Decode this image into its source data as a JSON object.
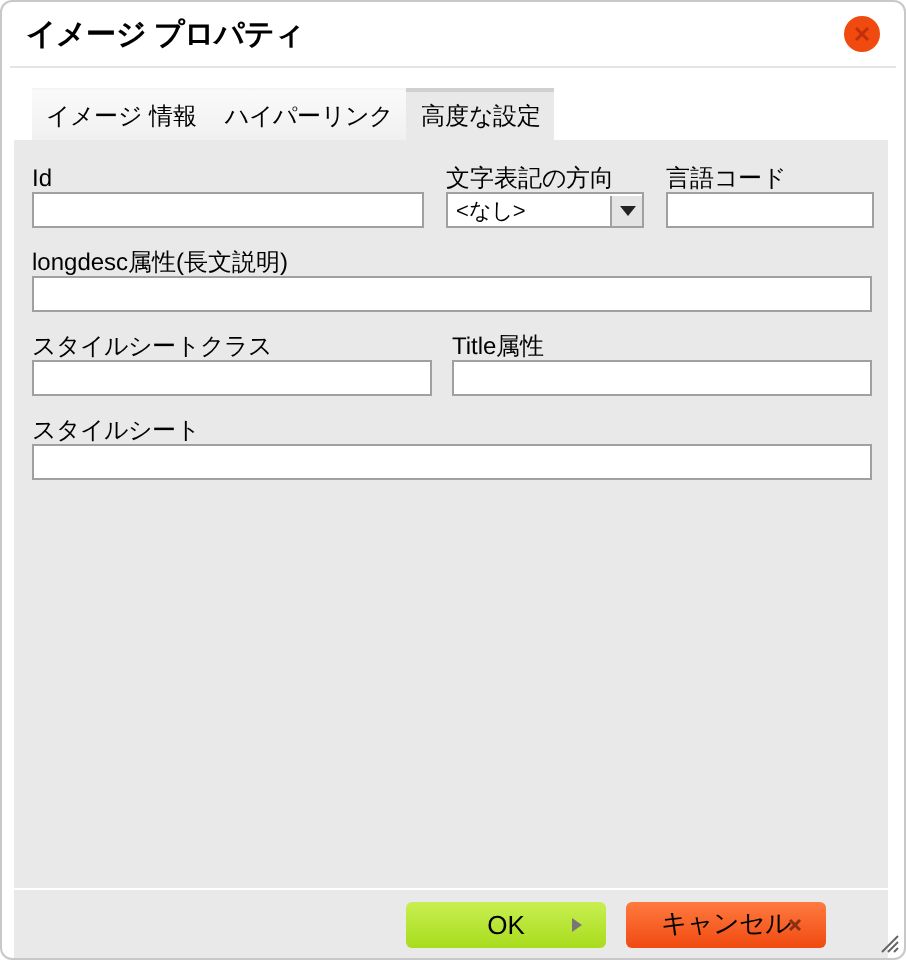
{
  "window": {
    "title": "イメージ プロパティ"
  },
  "tabs": [
    {
      "label": "イメージ 情報",
      "selected": false
    },
    {
      "label": "ハイパーリンク",
      "selected": false
    },
    {
      "label": "高度な設定",
      "selected": true
    }
  ],
  "rows": [
    [
      {
        "label": "Id",
        "kind": "text"
      },
      {
        "label": "文字表記の方向",
        "kind": "select",
        "value": "<なし>"
      },
      {
        "label": "言語コード",
        "kind": "text"
      }
    ],
    [
      {
        "label": "longdesc属性(長文説明)",
        "kind": "text"
      }
    ],
    [
      {
        "label": "スタイルシートクラス",
        "kind": "text"
      },
      {
        "label": "Title属性",
        "kind": "text"
      }
    ],
    [
      {
        "label": "スタイルシート",
        "kind": "text"
      }
    ]
  ],
  "buttons": [
    {
      "label": "OK",
      "kind": "ok"
    },
    {
      "label": "キャンセル",
      "kind": "cancel"
    }
  ]
}
